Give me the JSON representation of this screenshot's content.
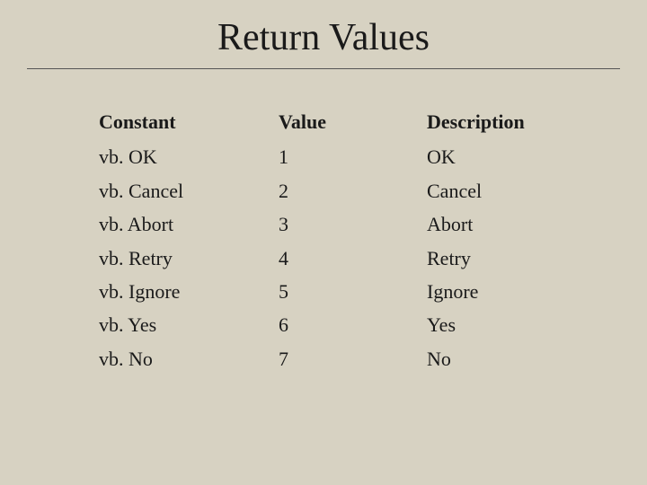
{
  "title": "Return Values",
  "table": {
    "headers": {
      "constant": "Constant",
      "value": "Value",
      "description": "Description"
    },
    "rows": [
      {
        "constant": "vb. OK",
        "value": "1",
        "description": "OK"
      },
      {
        "constant": "vb. Cancel",
        "value": "2",
        "description": "Cancel"
      },
      {
        "constant": "vb. Abort",
        "value": "3",
        "description": "Abort"
      },
      {
        "constant": "vb. Retry",
        "value": "4",
        "description": "Retry"
      },
      {
        "constant": "vb. Ignore",
        "value": "5",
        "description": "Ignore"
      },
      {
        "constant": "vb. Yes",
        "value": "6",
        "description": "Yes"
      },
      {
        "constant": "vb. No",
        "value": "7",
        "description": "No"
      }
    ]
  },
  "chart_data": {
    "type": "table",
    "title": "Return Values",
    "columns": [
      "Constant",
      "Value",
      "Description"
    ],
    "rows": [
      [
        "vb. OK",
        1,
        "OK"
      ],
      [
        "vb. Cancel",
        2,
        "Cancel"
      ],
      [
        "vb. Abort",
        3,
        "Abort"
      ],
      [
        "vb. Retry",
        4,
        "Retry"
      ],
      [
        "vb. Ignore",
        5,
        "Ignore"
      ],
      [
        "vb. Yes",
        6,
        "Yes"
      ],
      [
        "vb. No",
        7,
        "No"
      ]
    ]
  }
}
